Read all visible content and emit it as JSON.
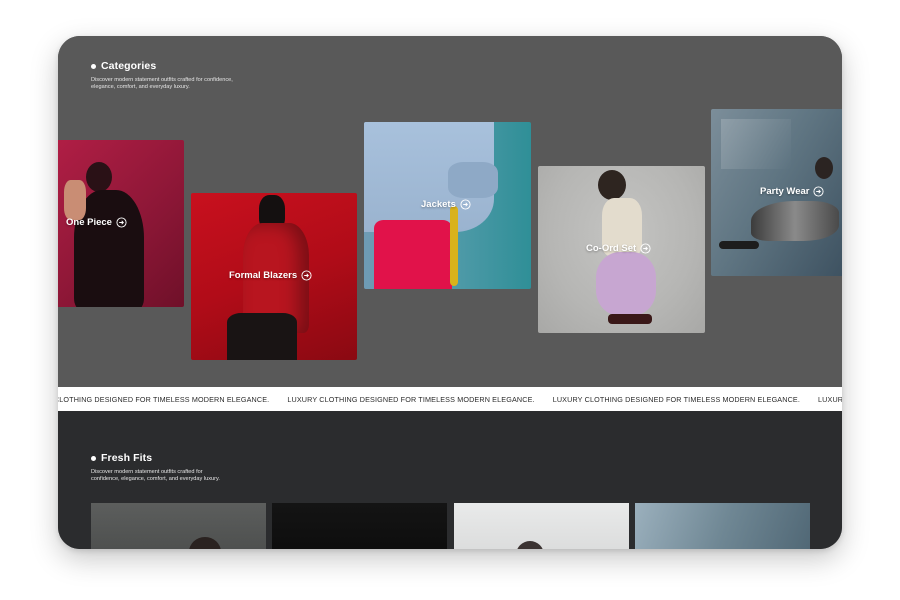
{
  "categories": {
    "title": "Categories",
    "description_line1": "Discover modern statement outfits crafted for confidence,",
    "description_line2": "elegance, comfort, and everyday luxury.",
    "items": [
      {
        "label": "One Piece",
        "icon": "arrow-right-circle-icon"
      },
      {
        "label": "Formal Blazers",
        "icon": "arrow-right-circle-icon"
      },
      {
        "label": "Jackets",
        "icon": "arrow-right-circle-icon"
      },
      {
        "label": "Co-Ord Set",
        "icon": "arrow-right-circle-icon"
      },
      {
        "label": "Party Wear",
        "icon": "arrow-right-circle-icon"
      }
    ]
  },
  "marquee": {
    "items": [
      "LUXURY CLOTHING DESIGNED FOR TIMELESS MODERN ELEGANCE.",
      "LUXURY CLOTHING DESIGNED FOR TIMELESS MODERN ELEGANCE.",
      "LUXURY CLOTHING DESIGNED FOR TIMELESS MODERN ELEGANCE.",
      "LUXURY CLOTHING DESIGNED FOR TIMELESS MODERN ELEGANCE."
    ]
  },
  "fresh_fits": {
    "title": "Fresh Fits",
    "description_line1": "Discover modern statement outfits crafted for",
    "description_line2": "confidence, elegance, comfort, and everyday luxury."
  },
  "colors": {
    "category_bg": "#595959",
    "dark_bg": "#2b2c2e",
    "marquee_bg": "#ffffff"
  }
}
